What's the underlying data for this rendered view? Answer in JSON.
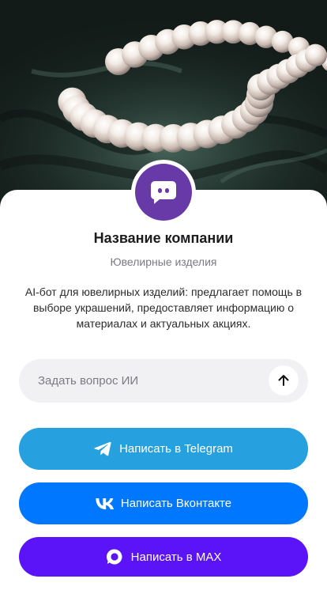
{
  "hero": {
    "image_description": "pearl-necklace-photo"
  },
  "company": {
    "avatar_icon": "chat-bot-icon",
    "name": "Название компании",
    "category": "Ювелирные изделия",
    "description": "AI-бот для ювелирных изделий: предлагает помощь в выборе украшений, предоставляет информацию о материалах и актуальных акциях."
  },
  "ask": {
    "placeholder": "Задать вопрос ИИ",
    "value": "",
    "send_icon": "arrow-up-icon"
  },
  "actions": {
    "telegram": {
      "label": "Написать в Telegram",
      "icon": "telegram-icon",
      "color": "#27a0df"
    },
    "vk": {
      "label": "Написать Вконтакте",
      "icon": "vk-icon",
      "color": "#0077ff"
    },
    "max": {
      "label": "Написать в MAX",
      "icon": "max-icon",
      "color": "#5b14f7"
    }
  },
  "colors": {
    "avatar_bg": "#673aa8",
    "input_bg": "#f1f1f3",
    "muted_text": "#7b7b80"
  }
}
